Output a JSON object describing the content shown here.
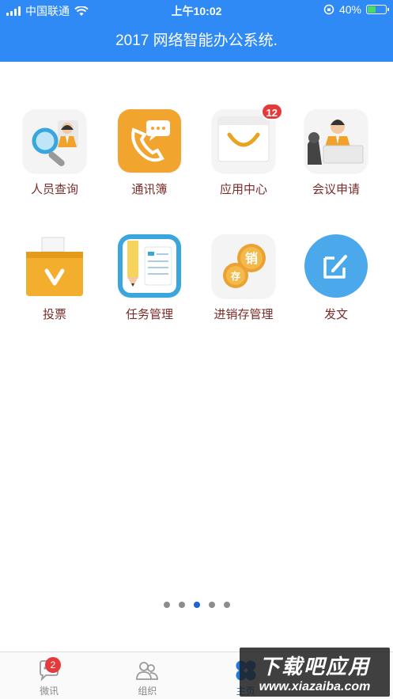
{
  "status_bar": {
    "carrier": "中国联通",
    "time": "上午10:02",
    "battery_percent": "40%",
    "battery_level": 0.4
  },
  "header": {
    "title": "2017 网络智能办公系统."
  },
  "apps": [
    {
      "label": "人员查询",
      "icon": "person-search-icon"
    },
    {
      "label": "通讯簿",
      "icon": "phone-chat-icon"
    },
    {
      "label": "应用中心",
      "icon": "shopping-bag-icon",
      "badge": "12"
    },
    {
      "label": "会议申请",
      "icon": "meeting-icon"
    },
    {
      "label": "投票",
      "icon": "ballot-box-icon"
    },
    {
      "label": "任务管理",
      "icon": "task-notebook-icon"
    },
    {
      "label": "进销存管理",
      "icon": "coins-icon",
      "coin_top": "销",
      "coin_bottom": "存"
    },
    {
      "label": "发文",
      "icon": "edit-doc-icon"
    }
  ],
  "pager": {
    "count": 5,
    "active_index": 2
  },
  "tabs": [
    {
      "label": "微讯",
      "icon": "chat-icon",
      "badge": "2"
    },
    {
      "label": "组织",
      "icon": "people-icon"
    },
    {
      "label": "主页",
      "icon": "grid-icon",
      "active": true
    },
    {
      "label": "",
      "icon": "hidden-tab-icon"
    }
  ],
  "watermark": {
    "line1": "下载吧应用",
    "line2": "www.xiazaiba.com"
  },
  "colors": {
    "primary": "#2f8af5",
    "label": "#7a2c28",
    "badge": "#e53a3a",
    "active_tab": "#1f7ad9"
  }
}
